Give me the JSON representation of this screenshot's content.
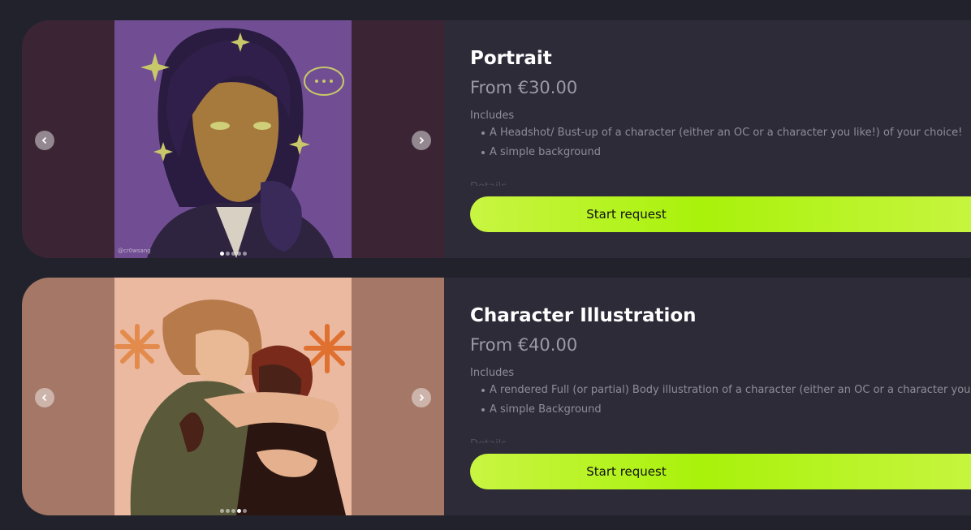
{
  "colors": {
    "accent": "#b5f21e",
    "card": "#2c2b37",
    "background": "#22222c"
  },
  "products": [
    {
      "title": "Portrait",
      "price": "From €30.00",
      "includes_label": "Includes",
      "includes": [
        "A Headshot/ Bust-up of a character (either an OC or a character you like!) of your choice!",
        "A simple background"
      ],
      "hidden_label": "Details",
      "cta": "Start request",
      "watermark": "@cr0wsang",
      "gallery": {
        "slides": 5,
        "active": 1
      },
      "prev_icon": "chevron-left-icon",
      "next_icon": "chevron-right-icon"
    },
    {
      "title": "Character Illustration",
      "price": "From €40.00",
      "includes_label": "Includes",
      "includes": [
        "A rendered Full (or partial) Body illustration of a character (either an OC or a character you like)",
        "A simple Background"
      ],
      "hidden_label": "Details",
      "cta": "Start request",
      "gallery": {
        "slides": 5,
        "active": 4
      },
      "prev_icon": "chevron-left-icon",
      "next_icon": "chevron-right-icon"
    }
  ]
}
